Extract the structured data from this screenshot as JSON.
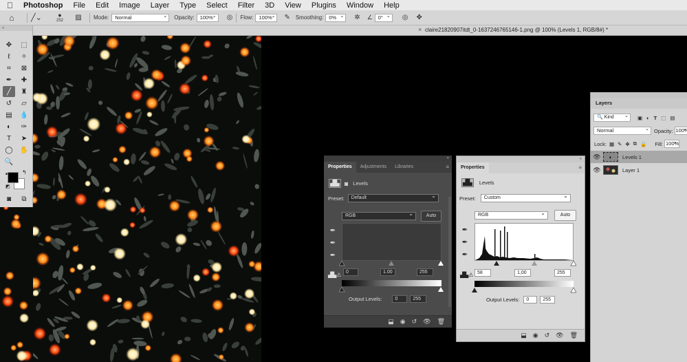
{
  "menubar": {
    "app": "Photoshop",
    "items": [
      "File",
      "Edit",
      "Image",
      "Layer",
      "Type",
      "Select",
      "Filter",
      "3D",
      "View",
      "Plugins",
      "Window",
      "Help"
    ]
  },
  "options": {
    "brush_size": "252",
    "mode_label": "Mode:",
    "mode_value": "Normal",
    "opacity_label": "Opacity:",
    "opacity_value": "100%",
    "flow_label": "Flow:",
    "flow_value": "100%",
    "smoothing_label": "Smoothing:",
    "smoothing_value": "0%",
    "angle_value": "0°"
  },
  "document": {
    "tab_title": "claire21820907itdt_0-1637246765146-1.png @ 100% (Levels 1, RGB/8#) *"
  },
  "properties_dark": {
    "tabs": [
      "Properties",
      "Adjustments",
      "Libraries"
    ],
    "title": "Levels",
    "preset_label": "Preset:",
    "preset_value": "Default",
    "channel": "RGB",
    "auto": "Auto",
    "input_black": "0",
    "input_gamma": "1.00",
    "input_white": "255",
    "output_label": "Output Levels:",
    "output_black": "0",
    "output_white": "255"
  },
  "properties_light": {
    "tab": "Properties",
    "title": "Levels",
    "preset_label": "Preset:",
    "preset_value": "Custom",
    "channel": "RGB",
    "auto": "Auto",
    "input_black": "58",
    "input_gamma": "1,00",
    "input_white": "255",
    "output_label": "Output Levels:",
    "output_black": "0",
    "output_white": "255"
  },
  "layers": {
    "title": "Layers",
    "filter_kind": "Kind",
    "blend_mode": "Normal",
    "opacity_label": "Opacity:",
    "opacity_value": "100%",
    "lock_label": "Lock:",
    "fill_label": "Fill:",
    "fill_value": "100%",
    "items": [
      {
        "name": "Levels 1",
        "selected": true
      },
      {
        "name": "Layer 1",
        "selected": false
      }
    ]
  },
  "colors": {
    "foreground": "#000000",
    "background": "#ffffff"
  }
}
